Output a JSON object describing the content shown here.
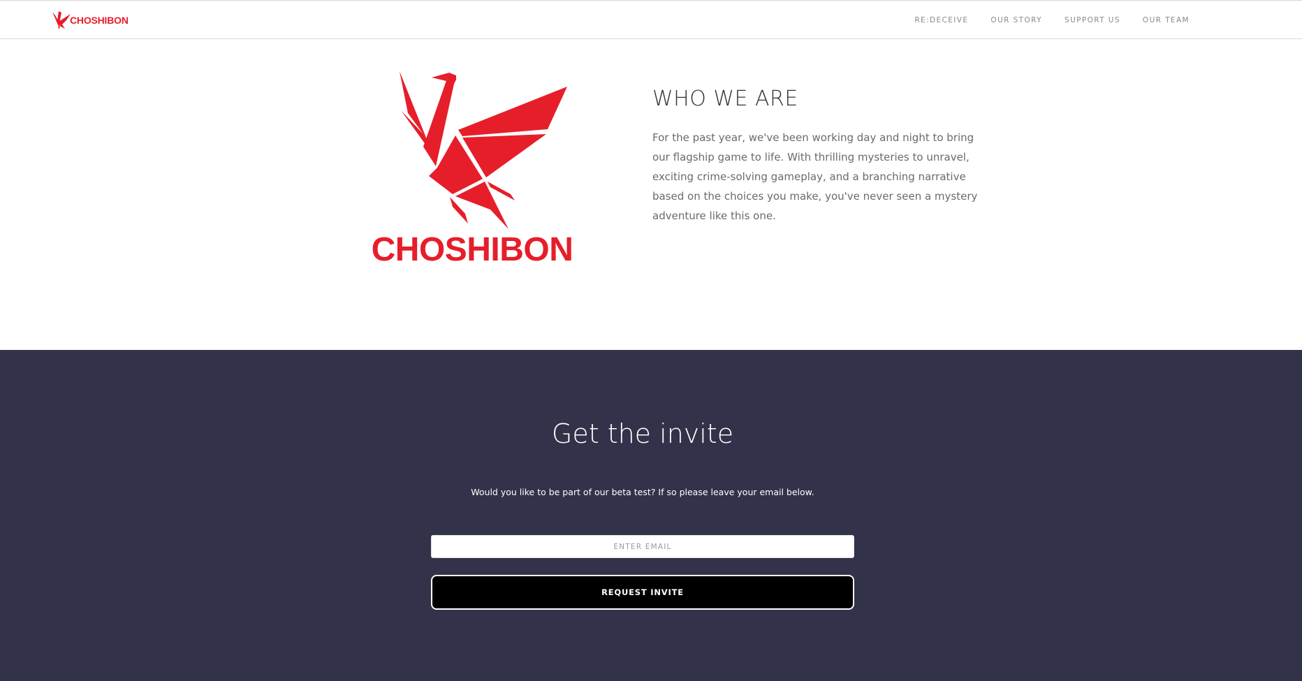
{
  "brand": {
    "name": "CHOSHIBON",
    "color": "#e61e2a",
    "icon": "origami-crane-icon"
  },
  "nav": {
    "items": [
      {
        "label": "RE:DECEIVE"
      },
      {
        "label": "OUR STORY"
      },
      {
        "label": "SUPPORT US"
      },
      {
        "label": "OUR TEAM"
      }
    ]
  },
  "about": {
    "logo_text": "CHOSHIBON",
    "title": "WHO WE ARE",
    "body": "For the past year, we've been working day and night to bring our flagship game to life. With thrilling mysteries to unravel, exciting crime-solving gameplay, and a branching narrative based on the choices you make, you've never seen a mystery adventure like this one."
  },
  "invite": {
    "title": "Get the invite",
    "subtitle": "Would you like to be part of our beta test? If so please leave your email below.",
    "email_placeholder": "ENTER EMAIL",
    "email_value": "",
    "button_label": "REQUEST INVITE",
    "background_color": "#32324a"
  }
}
